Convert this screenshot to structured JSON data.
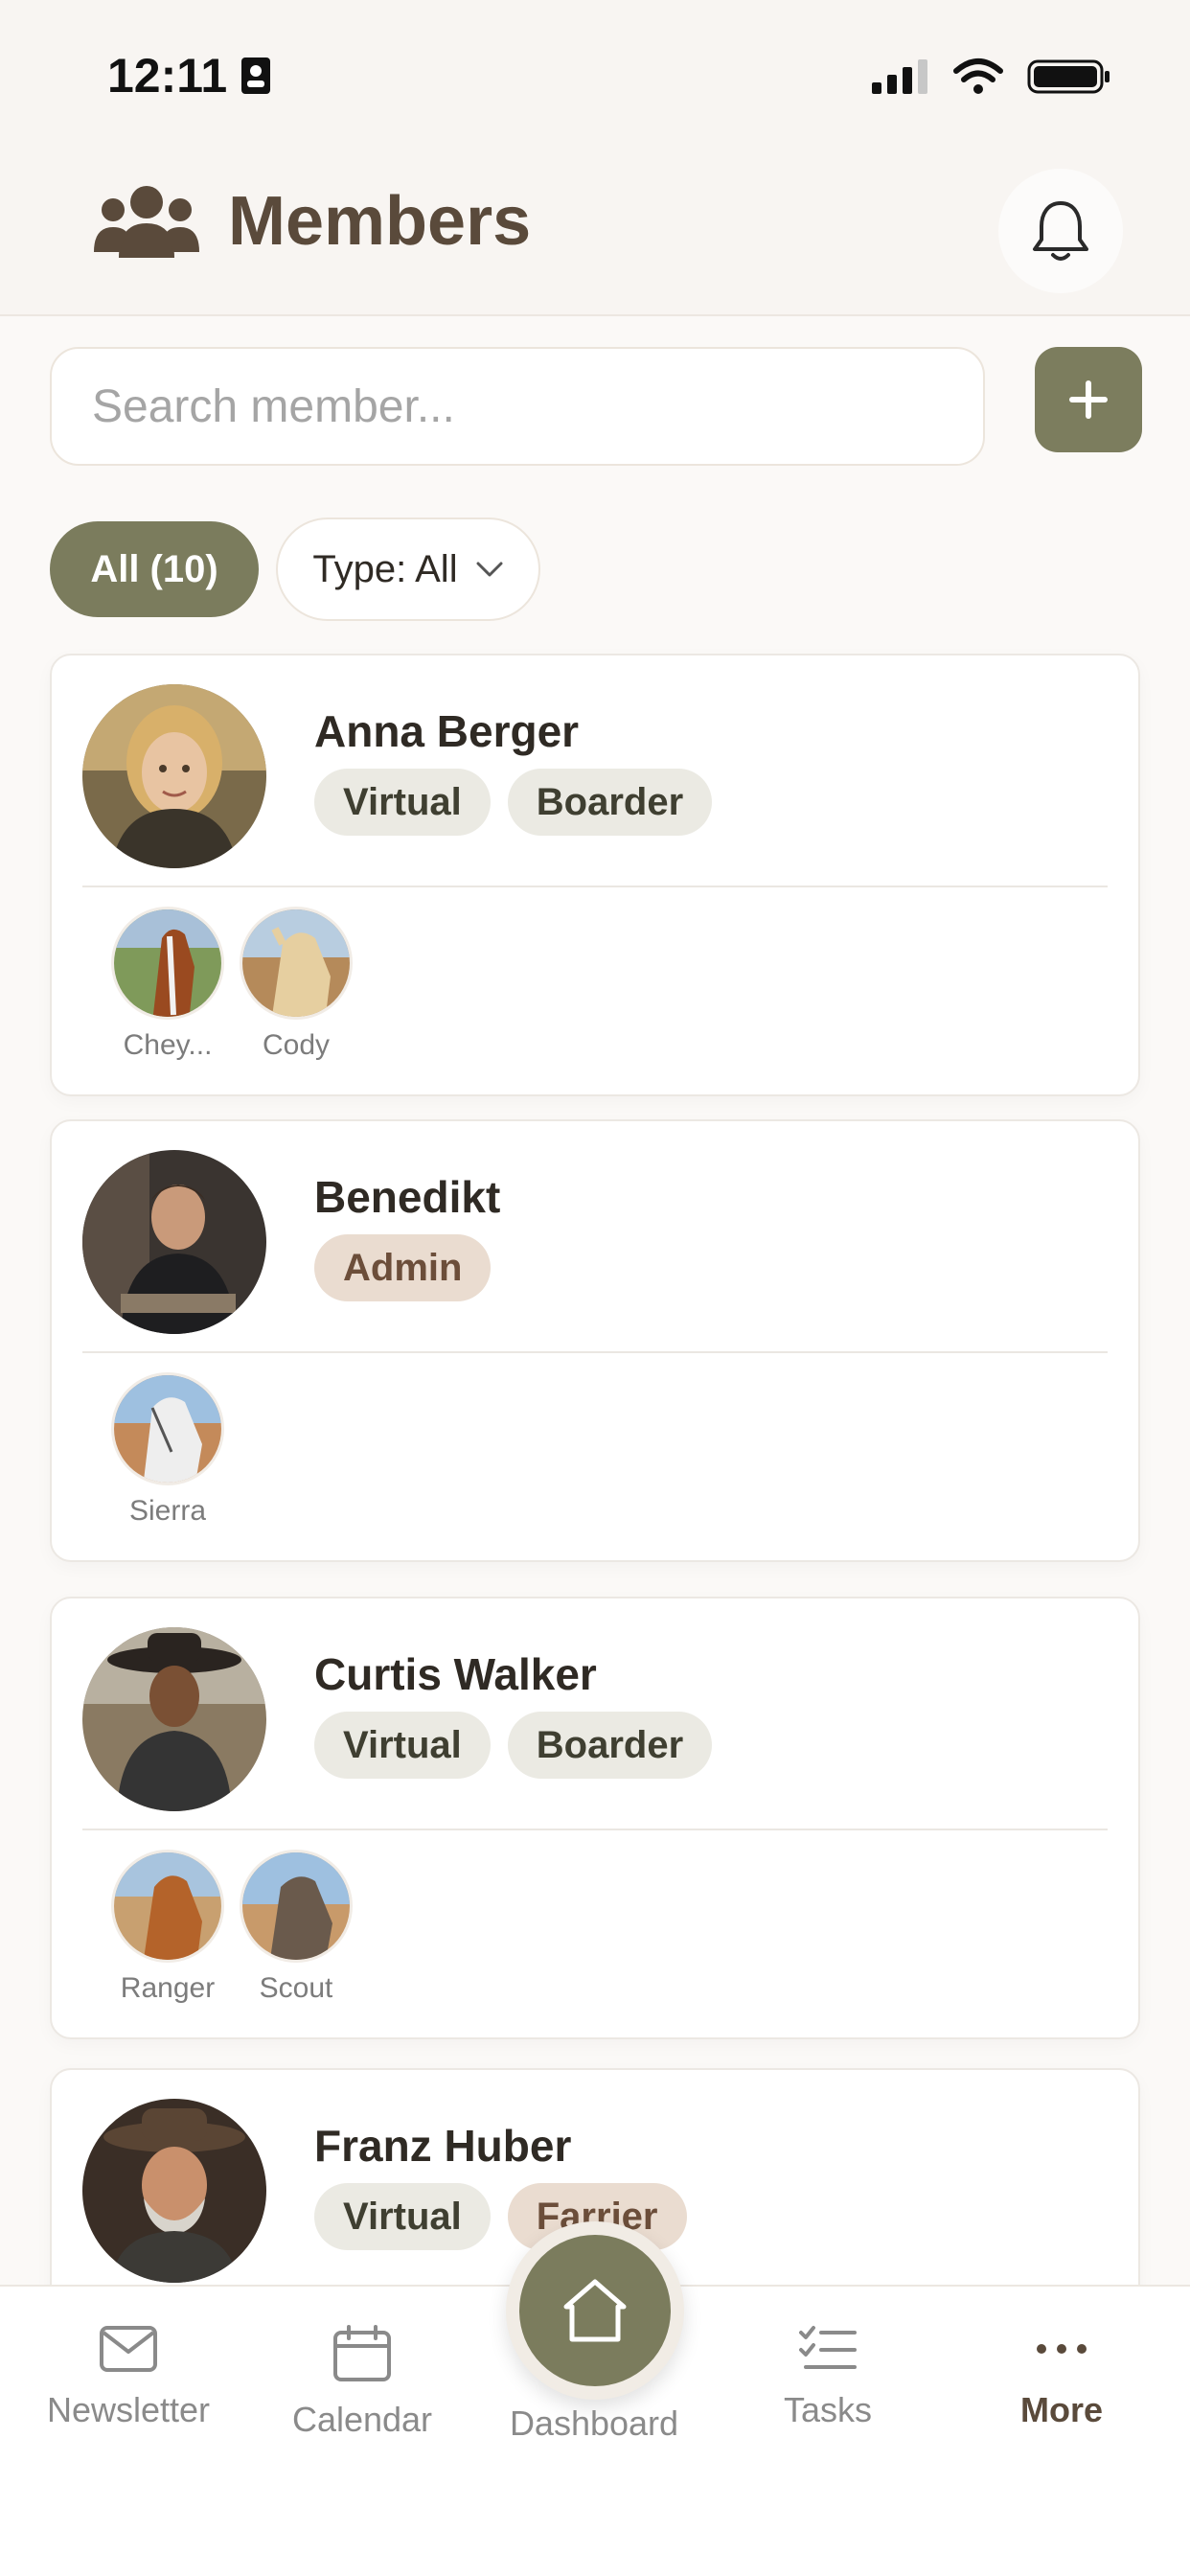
{
  "status_bar": {
    "time": "12:11"
  },
  "header": {
    "title": "Members"
  },
  "search": {
    "placeholder": "Search member..."
  },
  "filters": {
    "all_label": "All (10)",
    "type_label": "Type: All"
  },
  "members": [
    {
      "name": "Anna Berger",
      "tags": [
        "Virtual",
        "Boarder"
      ],
      "horses": [
        "Chey...",
        "Cody"
      ]
    },
    {
      "name": "Benedikt",
      "tags": [
        "Admin"
      ],
      "horses": [
        "Sierra"
      ]
    },
    {
      "name": "Curtis Walker",
      "tags": [
        "Virtual",
        "Boarder"
      ],
      "horses": [
        "Ranger",
        "Scout"
      ]
    },
    {
      "name": "Franz Huber",
      "tags": [
        "Virtual",
        "Farrier"
      ],
      "horses": []
    }
  ],
  "nav": {
    "newsletter": "Newsletter",
    "calendar": "Calendar",
    "dashboard": "Dashboard",
    "tasks": "Tasks",
    "more": "More"
  },
  "colors": {
    "accent": "#7b7c5d",
    "title": "#5a4a3b",
    "background": "#fbf9f7"
  }
}
